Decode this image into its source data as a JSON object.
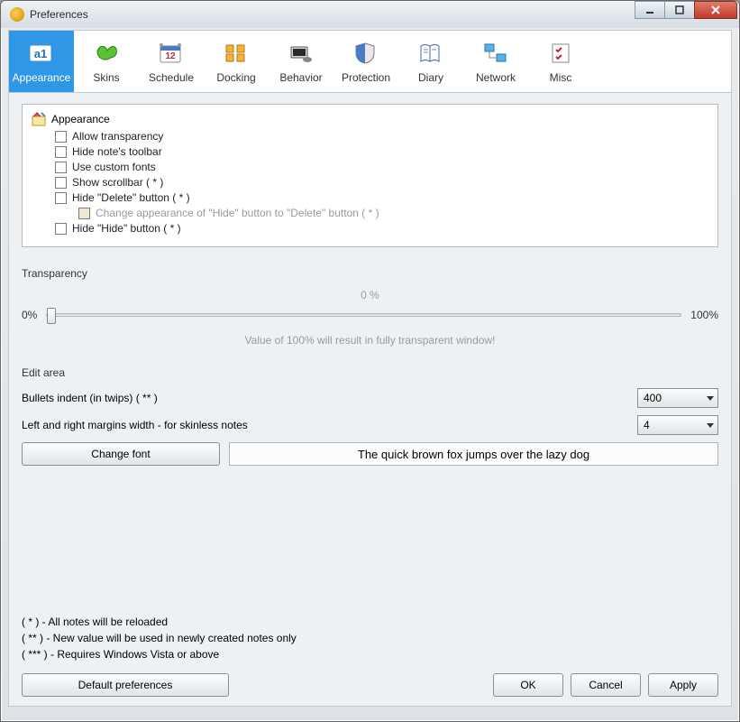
{
  "window": {
    "title": "Preferences"
  },
  "tabs": [
    {
      "label": "Appearance"
    },
    {
      "label": "Skins"
    },
    {
      "label": "Schedule"
    },
    {
      "label": "Docking"
    },
    {
      "label": "Behavior"
    },
    {
      "label": "Protection"
    },
    {
      "label": "Diary"
    },
    {
      "label": "Network"
    },
    {
      "label": "Misc"
    }
  ],
  "appearance_tree": {
    "title": "Appearance",
    "items": [
      {
        "label": "Allow transparency"
      },
      {
        "label": "Hide note's toolbar"
      },
      {
        "label": "Use custom fonts"
      },
      {
        "label": "Show scrollbar ( * )"
      },
      {
        "label": "Hide \"Delete\" button ( * )"
      },
      {
        "label": "Change appearance of \"Hide\" button to \"Delete\" button ( * )"
      },
      {
        "label": "Hide \"Hide\" button ( * )"
      }
    ]
  },
  "transparency": {
    "title": "Transparency",
    "value_label": "0 %",
    "min_label": "0%",
    "max_label": "100%",
    "hint": "Value of 100% will result in fully transparent window!"
  },
  "edit_area": {
    "title": "Edit area",
    "bullets_label": "Bullets indent (in twips) ( ** )",
    "bullets_value": "400",
    "margins_label": "Left and right margins width - for skinless notes",
    "margins_value": "4",
    "change_font_label": "Change font",
    "sample_text": "The quick brown fox jumps over the lazy dog"
  },
  "footnotes": [
    "( * ) - All notes will be reloaded",
    "( ** ) - New value will be used in newly created notes only",
    "( *** ) - Requires Windows Vista or above"
  ],
  "buttons": {
    "default": "Default preferences",
    "ok": "OK",
    "cancel": "Cancel",
    "apply": "Apply"
  }
}
